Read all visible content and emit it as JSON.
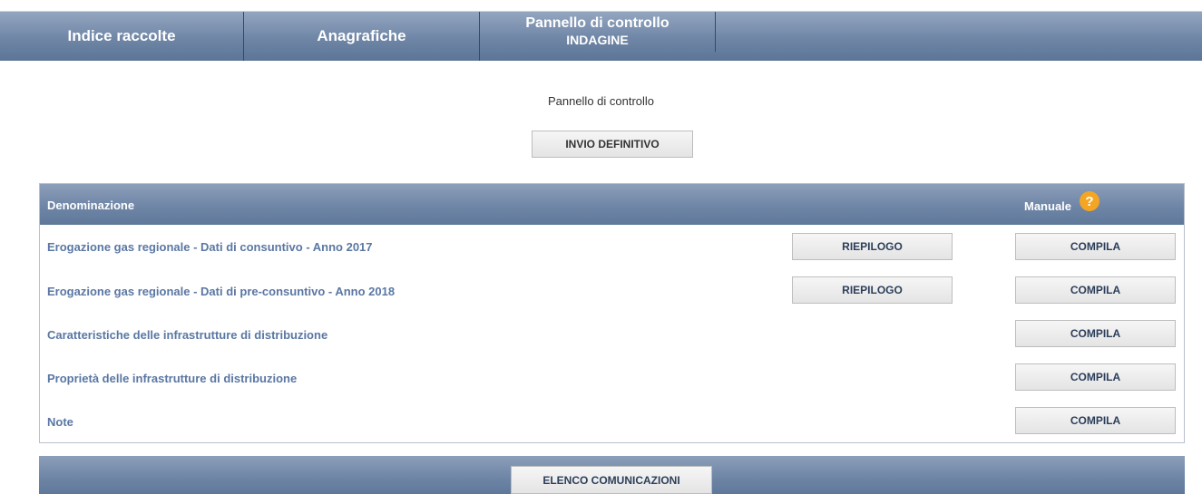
{
  "nav": {
    "items": [
      "Indice raccolte",
      "Anagrafiche"
    ],
    "panel_line1": "Pannello di controllo",
    "panel_line2": "INDAGINE"
  },
  "page": {
    "title": "Pannello di controllo",
    "invio_button": "INVIO DEFINITIVO"
  },
  "table": {
    "header_denominazione": "Denominazione",
    "header_manuale": "Manuale",
    "help_glyph": "?",
    "help_color": "#f4a622",
    "rows": [
      {
        "label": "Erogazione gas regionale - Dati di consuntivo - Anno 2017",
        "riepilogo": "RIEPILOGO",
        "compila": "COMPILA"
      },
      {
        "label": "Erogazione gas regionale - Dati di pre-consuntivo - Anno 2018",
        "riepilogo": "RIEPILOGO",
        "compila": "COMPILA"
      },
      {
        "label": "Caratteristiche delle infrastrutture di distribuzione",
        "compila": "COMPILA"
      },
      {
        "label": "Proprietà delle infrastrutture di distribuzione",
        "compila": "COMPILA"
      },
      {
        "label": "Note",
        "compila": "COMPILA"
      }
    ]
  },
  "footer": {
    "elenco_button": "ELENCO COMUNICAZIONI"
  }
}
